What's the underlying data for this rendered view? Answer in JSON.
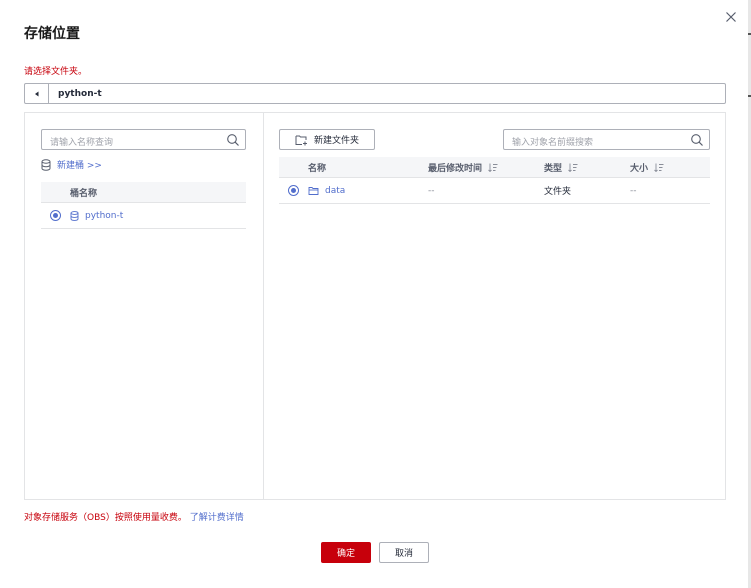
{
  "dialog": {
    "title": "存储位置",
    "hint": "请选择文件夹。",
    "current_path": "python-t"
  },
  "left_panel": {
    "search_placeholder": "请输入名称查询",
    "new_bucket_label": "新建桶 >>",
    "column_header": "桶名称",
    "buckets": [
      {
        "name": "python-t",
        "selected": true
      }
    ]
  },
  "right_panel": {
    "new_folder_label": "新建文件夹",
    "search_placeholder": "输入对象名前缀搜索",
    "columns": {
      "name": "名称",
      "modified": "最后修改时间",
      "type": "类型",
      "size": "大小"
    },
    "rows": [
      {
        "name": "data",
        "modified": "--",
        "type": "文件夹",
        "size": "--",
        "selected": true
      }
    ]
  },
  "footer": {
    "billing_text": "对象存储服务（OBS）按照使用量收费。",
    "billing_link": "了解计费详情",
    "ok_label": "确定",
    "cancel_label": "取消"
  },
  "colors": {
    "accent": "#526ecc",
    "danger": "#c7000b"
  }
}
